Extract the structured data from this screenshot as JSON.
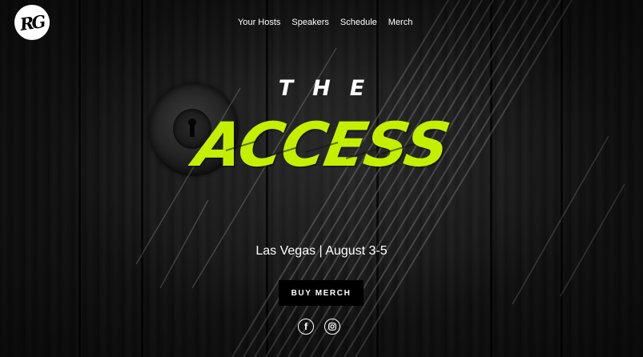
{
  "logo": {
    "text": "RG"
  },
  "nav": [
    {
      "label": "Your Hosts"
    },
    {
      "label": "Speakers"
    },
    {
      "label": "Schedule"
    },
    {
      "label": "Merch"
    }
  ],
  "hero": {
    "title_small": "THE",
    "title_main": "ACCESS",
    "subtitle": "Las Vegas | August 3-5",
    "cta_label": "BUY MERCH",
    "accent_color": "#c4f000"
  },
  "social": [
    {
      "icon": "facebook-icon"
    },
    {
      "icon": "instagram-icon"
    }
  ]
}
